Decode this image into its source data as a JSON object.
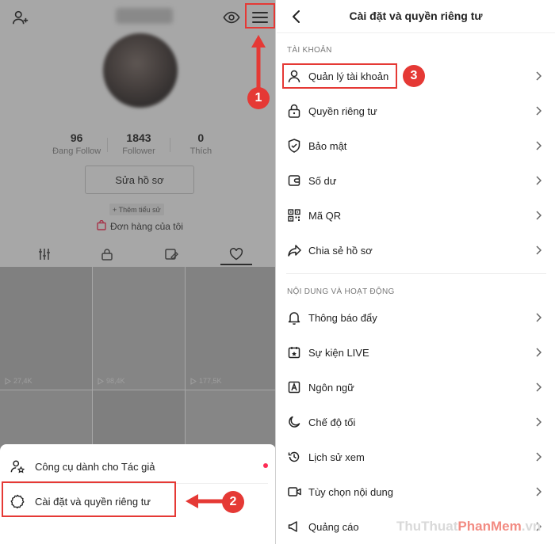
{
  "left": {
    "stats": [
      {
        "num": "96",
        "label": "Đang Follow"
      },
      {
        "num": "1843",
        "label": "Follower"
      },
      {
        "num": "0",
        "label": "Thích"
      }
    ],
    "edit_profile": "Sửa hồ sơ",
    "add_bio": "+ Thêm tiểu sử",
    "orders": "Đơn hàng của tôi",
    "videos": [
      {
        "views": "27,4K"
      },
      {
        "views": "98,4K"
      },
      {
        "views": "177,5K"
      }
    ],
    "sheet": {
      "creator_tools": "Công cụ dành cho Tác giả",
      "settings": "Cài đặt và quyền riêng tư"
    }
  },
  "annotations": {
    "badge1": "1",
    "badge2": "2",
    "badge3": "3"
  },
  "right": {
    "title": "Cài đặt và quyền riêng tư",
    "section_account": "TÀI KHOẢN",
    "account_items": [
      {
        "label": "Quản lý tài khoản",
        "icon": "person-icon"
      },
      {
        "label": "Quyền riêng tư",
        "icon": "lock-icon"
      },
      {
        "label": "Bảo mật",
        "icon": "shield-icon"
      },
      {
        "label": "Số dư",
        "icon": "wallet-icon"
      },
      {
        "label": "Mã QR",
        "icon": "qr-icon"
      },
      {
        "label": "Chia sẻ hồ sơ",
        "icon": "share-icon"
      }
    ],
    "section_content": "NỘI DUNG VÀ HOẠT ĐỘNG",
    "content_items": [
      {
        "label": "Thông báo đẩy",
        "icon": "bell-icon"
      },
      {
        "label": "Sự kiện LIVE",
        "icon": "calendar-icon"
      },
      {
        "label": "Ngôn ngữ",
        "icon": "language-icon"
      },
      {
        "label": "Chế độ tối",
        "icon": "moon-icon"
      },
      {
        "label": "Lịch sử xem",
        "icon": "history-icon"
      },
      {
        "label": "Tùy chọn nội dung",
        "icon": "video-icon"
      },
      {
        "label": "Quảng cáo",
        "icon": "megaphone-icon"
      }
    ]
  },
  "watermark": {
    "part1": "ThuThuat",
    "part2": "PhanMem",
    "part3": ".vn"
  },
  "colors": {
    "annotation_red": "#e53935",
    "tiktok_red": "#fe2c55"
  }
}
